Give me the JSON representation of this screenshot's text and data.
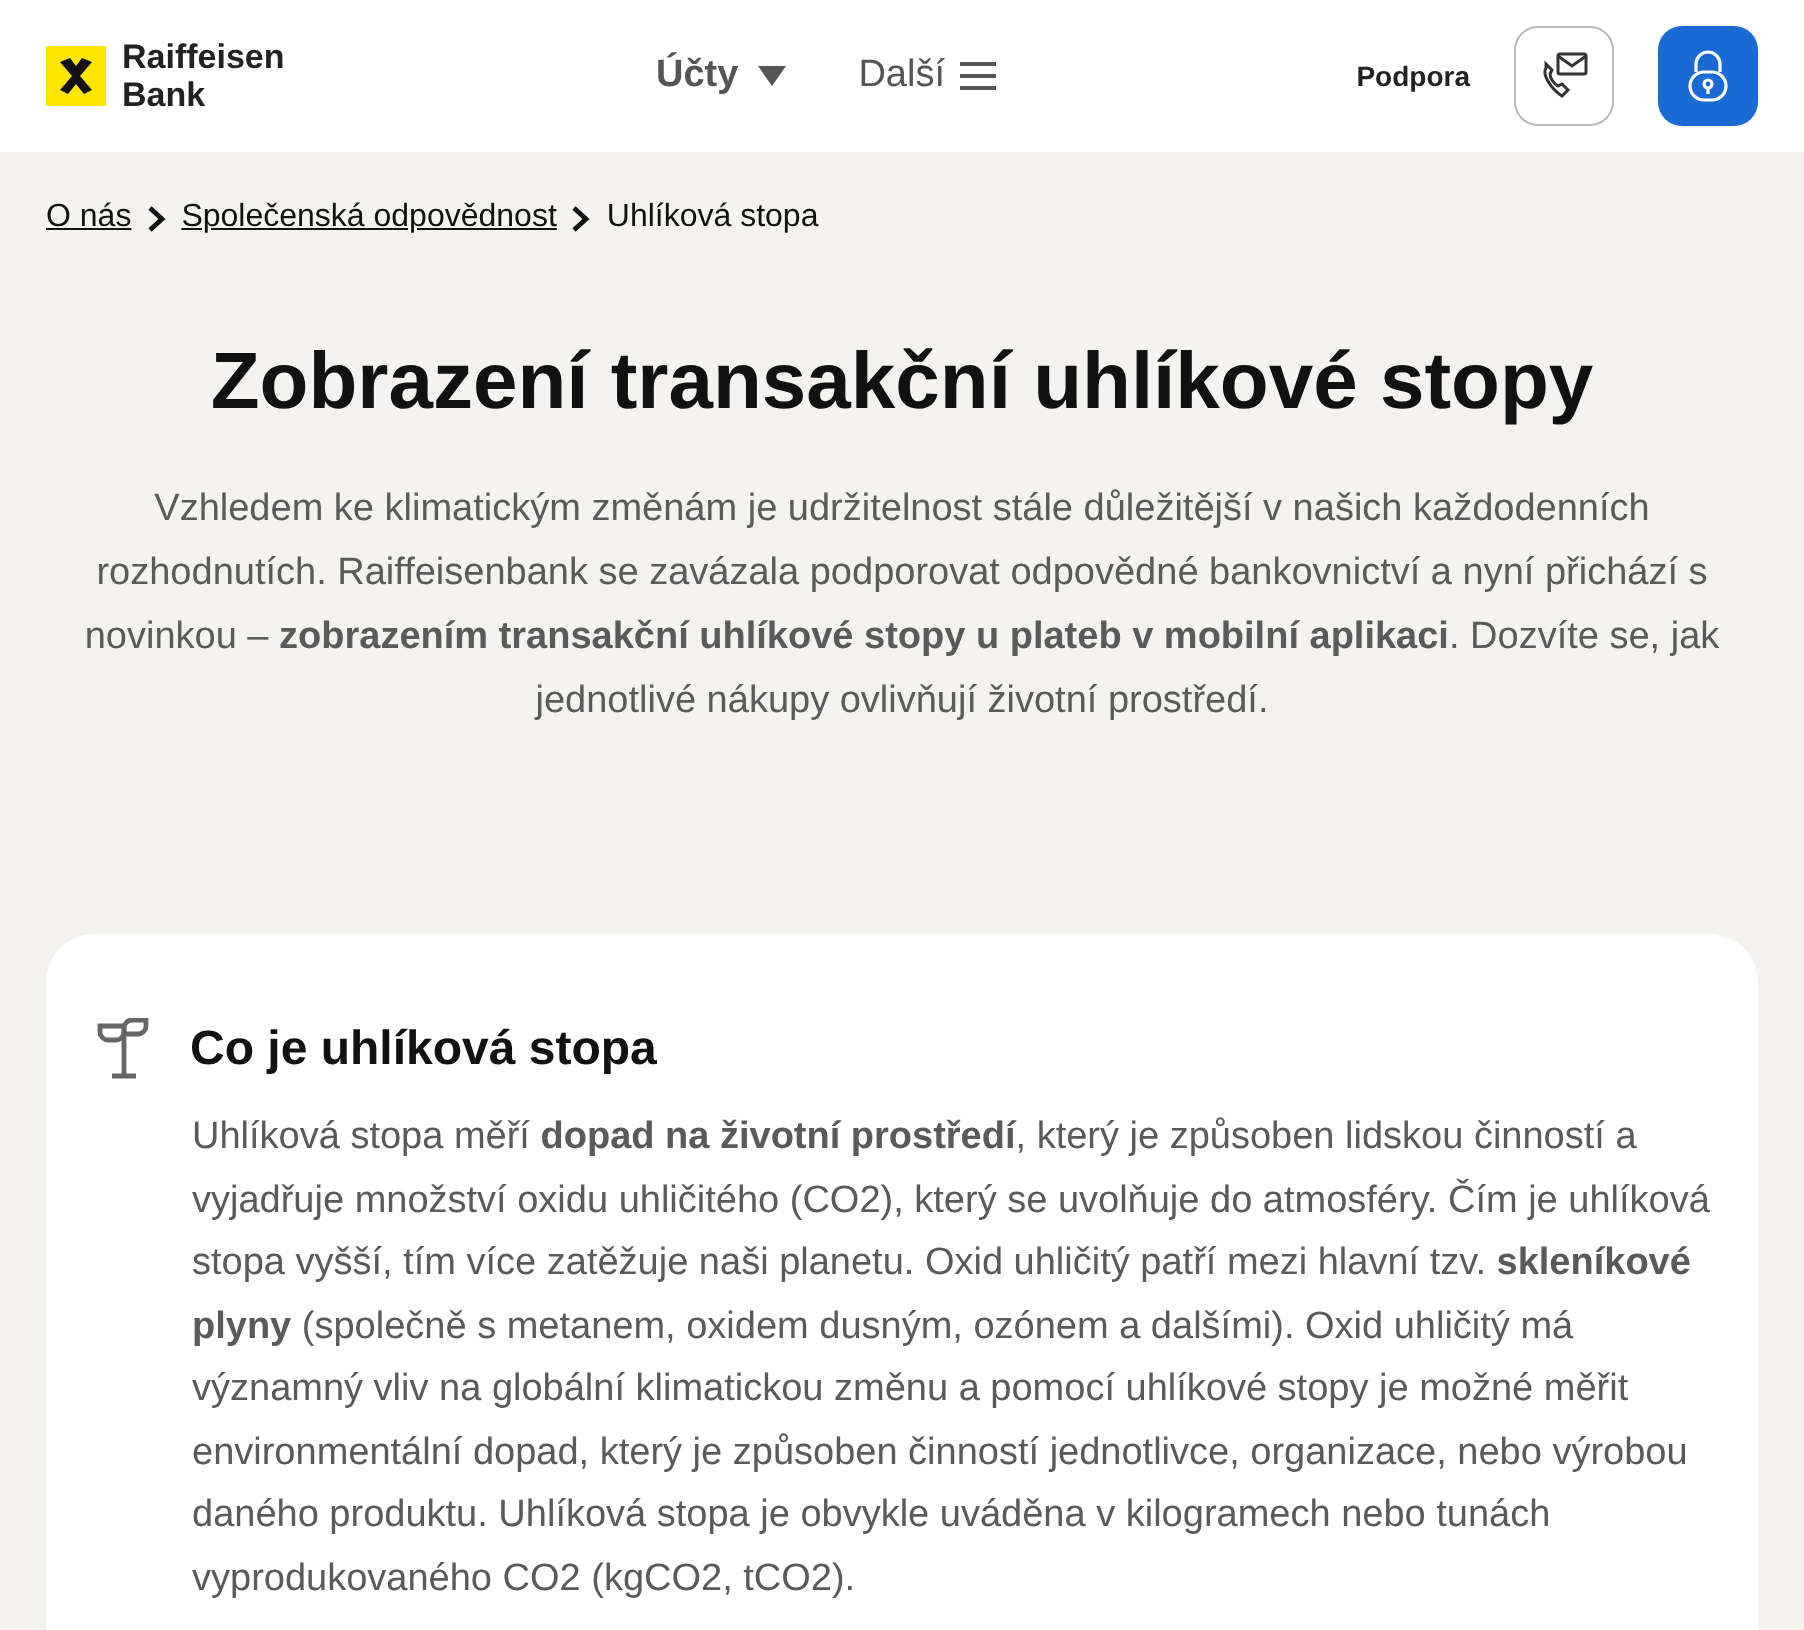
{
  "header": {
    "logo_lines": [
      "Raiffeisen",
      "Bank"
    ],
    "nav": [
      {
        "label": "Účty",
        "kind": "dropdown"
      },
      {
        "label": "Další",
        "kind": "menu"
      }
    ],
    "support_link": "Podpora"
  },
  "breadcrumb": [
    {
      "label": "O nás",
      "kind": "link"
    },
    {
      "label": "Společenská odpovědnost",
      "kind": "link"
    },
    {
      "label": "Uhlíková stopa",
      "kind": "current"
    }
  ],
  "title": "Zobrazení transakční uhlíkové stopy",
  "intro": "Vzhledem ke klimatickým změnám je udržitelnost stále důležitější v našich každodenních rozhodnutích. Raiffeisenbank se zavázala podporovat odpovědné bankovnictví a nyní přichází s novinkou – **zobrazením transakční uhlíkové stopy u plateb v mobilní aplikaci**. Dozvíte se, jak jednotlivé nákupy ovlivňují životní prostředí.",
  "card": {
    "heading": "Co je uhlíková stopa",
    "text": "Uhlíková stopa měří **dopad na životní prostředí**, který je způsoben lidskou činností a vyjadřuje množství oxidu uhličitého (CO2), který se uvolňuje do atmosféry. Čím je uhlíková stopa vyšší, tím více zatěžuje naši planetu. Oxid uhličitý patří mezi hlavní tzv. **skleníkové plyny** (společně s metanem, oxidem dusným, ozónem a dalšími). Oxid uhličitý má významný vliv na globální klimatickou změnu a pomocí uhlíkové stopy je možné měřit environmentální dopad, který je způsoben činností jednotlivce, organizace, nebo výrobou daného produktu. Uhlíková stopa je obvykle uváděna v kilogramech nebo tunách vyprodukovaného CO2 (kgCO2, tCO2)."
  }
}
